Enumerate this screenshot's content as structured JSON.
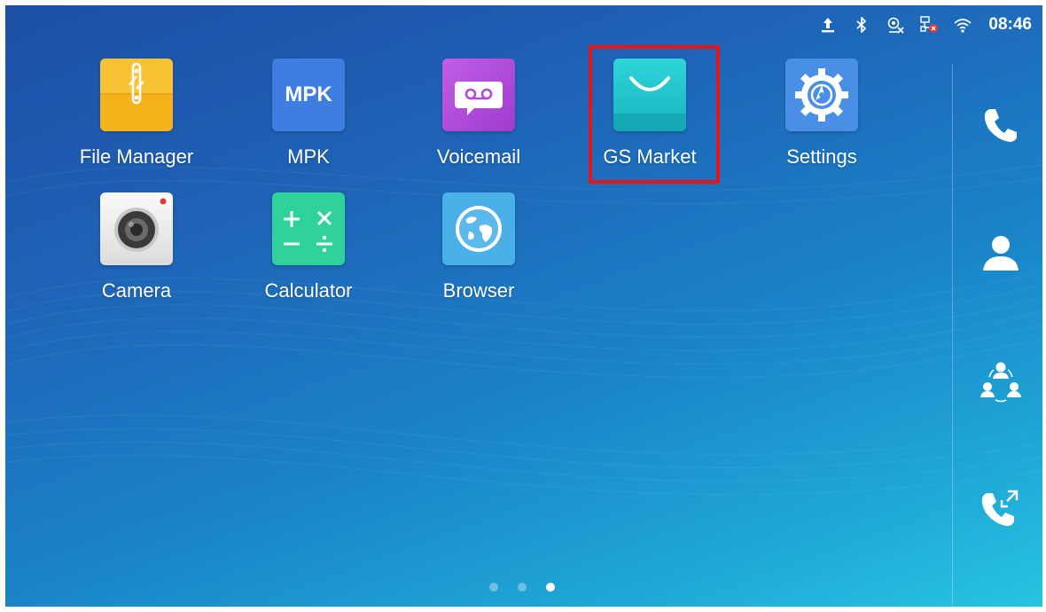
{
  "status_bar": {
    "icons": [
      "upload-icon",
      "bluetooth-icon",
      "camera-off-icon",
      "network-error-icon",
      "wifi-icon"
    ],
    "time": "08:46"
  },
  "apps": [
    {
      "label": "File Manager",
      "icon": "file-manager-icon",
      "color": "#f6b21b"
    },
    {
      "label": "MPK",
      "icon": "mpk-icon",
      "icon_text": "MPK",
      "color": "#3d7ee0"
    },
    {
      "label": "Voicemail",
      "icon": "voicemail-icon",
      "color": "#b54ad8"
    },
    {
      "label": "GS Market",
      "icon": "gs-market-icon",
      "color": "#1fbfc9",
      "highlighted": true
    },
    {
      "label": "Settings",
      "icon": "settings-icon",
      "color": "#4a8fe6"
    },
    {
      "label": "Camera",
      "icon": "camera-icon",
      "color": "#eeeeee"
    },
    {
      "label": "Calculator",
      "icon": "calculator-icon",
      "color": "#2fd39a"
    },
    {
      "label": "Browser",
      "icon": "browser-icon",
      "color": "#4ab0e8"
    }
  ],
  "dock": {
    "items": [
      "phone-icon",
      "contacts-icon",
      "conference-icon",
      "call-transfer-icon"
    ]
  },
  "pager": {
    "pages": 3,
    "current": 3
  },
  "colors": {
    "highlight": "#e8141a",
    "background_top": "#1c4fa6",
    "background_bottom": "#28c4e0"
  }
}
